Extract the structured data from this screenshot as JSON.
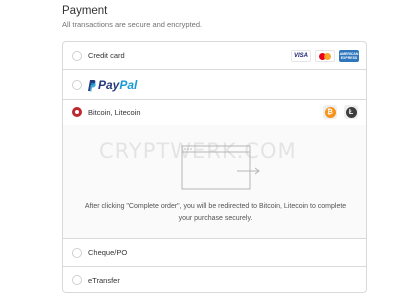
{
  "header": {
    "title": "Payment",
    "subtitle": "All transactions are secure and encrypted."
  },
  "methods": {
    "credit_card": {
      "label": "Credit card",
      "brands": [
        "VISA",
        "Mastercard",
        "American Express"
      ],
      "visa_text": "VISA",
      "amex_text": "AMERICAN EXPRESS"
    },
    "paypal": {
      "word_a": "Pay",
      "word_b": "Pal"
    },
    "crypto": {
      "label": "Bitcoin, Litecoin",
      "btc_symbol": "₿",
      "ltc_symbol": "Ł"
    },
    "cheque": {
      "label": "Cheque/PO"
    },
    "etransfer": {
      "label": "eTransfer"
    }
  },
  "selected_method": "crypto",
  "redirect": {
    "text": "After clicking \"Complete order\", you will be redirected to Bitcoin, Litecoin to complete your purchase securely."
  },
  "watermark": "CRYPTWERK.COM",
  "colors": {
    "radio_selected": "#c0262d",
    "paypal_dark": "#253b80",
    "paypal_light": "#179bd7",
    "bitcoin": "#f7931a",
    "litecoin": "#3d3d3d",
    "amex": "#2e77bc"
  }
}
